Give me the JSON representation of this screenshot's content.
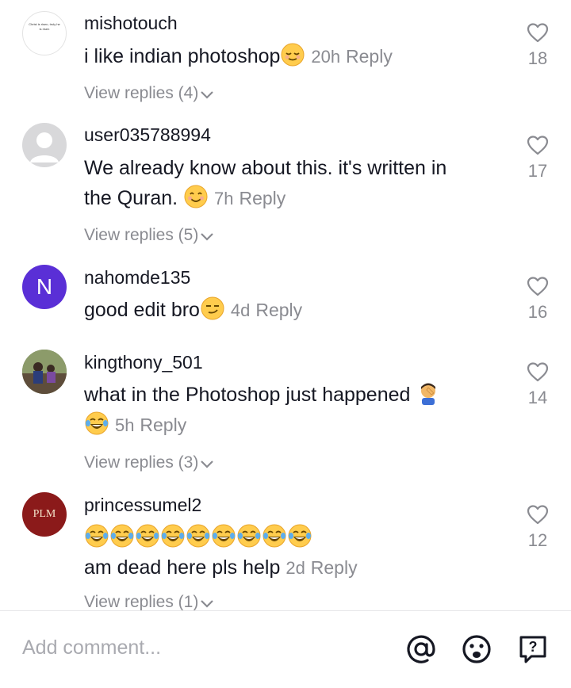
{
  "comments": [
    {
      "username": "mishotouch",
      "avatar_text": "Christ is risen, truly he is risen",
      "text": "i like indian photoshop",
      "time": "20h",
      "reply_label": "Reply",
      "likes": "18",
      "view_replies": "View replies (4)"
    },
    {
      "username": "user035788994",
      "text_line1": "We already know about this. it's written in",
      "text_line2": "the Quran.",
      "time": "7h",
      "reply_label": "Reply",
      "likes": "17",
      "view_replies": "View replies (5)"
    },
    {
      "username": "nahomde135",
      "avatar_letter": "N",
      "text": "good edit bro",
      "time": "4d",
      "reply_label": "Reply",
      "likes": "16"
    },
    {
      "username": "kingthony_501",
      "text": "what in the Photoshop just happened",
      "time": "5h",
      "reply_label": "Reply",
      "likes": "14",
      "view_replies": "View replies (3)"
    },
    {
      "username": "princessumel2",
      "avatar_text": "PLM",
      "text": "am dead here pls help",
      "time": "2d",
      "reply_label": "Reply",
      "likes": "12",
      "view_replies": "View replies (1)"
    }
  ],
  "composer": {
    "placeholder": "Add comment...",
    "icons": [
      "at-icon",
      "emoji-icon",
      "question-icon"
    ]
  },
  "colors": {
    "text": "#161823",
    "secondary": "#8a8b91",
    "avatar_n": "#5a2fd6",
    "avatar_plm": "#8b1a1a"
  }
}
